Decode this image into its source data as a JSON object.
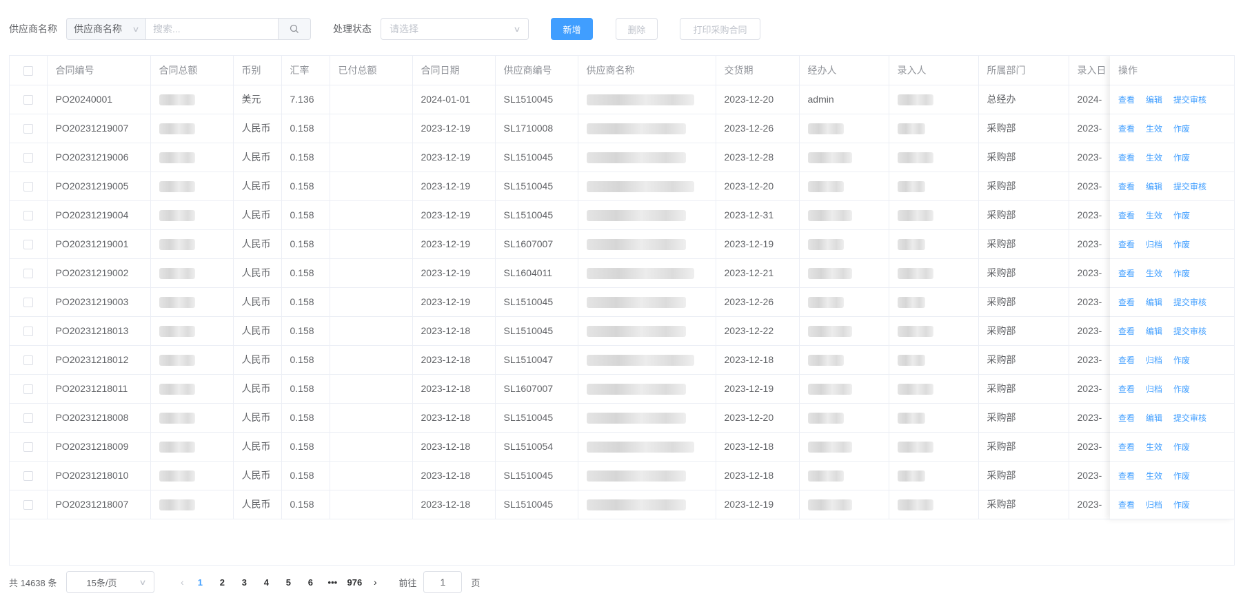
{
  "filters": {
    "supplier_label": "供应商名称",
    "supplier_select": "供应商名称",
    "search_placeholder": "搜索...",
    "status_label": "处理状态",
    "status_placeholder": "请选择"
  },
  "buttons": {
    "add": "新增",
    "delete": "删除",
    "print": "打印采购合同"
  },
  "table": {
    "headers": {
      "contract_no": "合同编号",
      "total": "合同总额",
      "currency": "币别",
      "rate": "汇率",
      "paid": "已付总额",
      "date": "合同日期",
      "supplier_no": "供应商编号",
      "supplier_name": "供应商名称",
      "delivery": "交货期",
      "handler": "经办人",
      "entered_by": "录入人",
      "dept": "所属部门",
      "entry_date": "录入日",
      "ops": "操作"
    },
    "rows": [
      {
        "no": "PO20240001",
        "currency": "美元",
        "rate": "7.136",
        "date": "2024-01-01",
        "supplier_no": "SL1510045",
        "delivery": "2023-12-20",
        "handler": "admin",
        "dept": "总经办",
        "entry": "2024-",
        "ops": [
          "查看",
          "编辑",
          "提交审核"
        ]
      },
      {
        "no": "PO20231219007",
        "currency": "人民币",
        "rate": "0.158",
        "date": "2023-12-19",
        "supplier_no": "SL1710008",
        "delivery": "2023-12-26",
        "handler": "",
        "dept": "采购部",
        "entry": "2023-",
        "ops": [
          "查看",
          "生效",
          "作废"
        ]
      },
      {
        "no": "PO20231219006",
        "currency": "人民币",
        "rate": "0.158",
        "date": "2023-12-19",
        "supplier_no": "SL1510045",
        "delivery": "2023-12-28",
        "handler": "",
        "dept": "采购部",
        "entry": "2023-",
        "ops": [
          "查看",
          "生效",
          "作废"
        ]
      },
      {
        "no": "PO20231219005",
        "currency": "人民币",
        "rate": "0.158",
        "date": "2023-12-19",
        "supplier_no": "SL1510045",
        "delivery": "2023-12-20",
        "handler": "",
        "dept": "采购部",
        "entry": "2023-",
        "ops": [
          "查看",
          "编辑",
          "提交审核"
        ]
      },
      {
        "no": "PO20231219004",
        "currency": "人民币",
        "rate": "0.158",
        "date": "2023-12-19",
        "supplier_no": "SL1510045",
        "delivery": "2023-12-31",
        "handler": "",
        "dept": "采购部",
        "entry": "2023-",
        "ops": [
          "查看",
          "生效",
          "作废"
        ]
      },
      {
        "no": "PO20231219001",
        "currency": "人民币",
        "rate": "0.158",
        "date": "2023-12-19",
        "supplier_no": "SL1607007",
        "delivery": "2023-12-19",
        "handler": "",
        "dept": "采购部",
        "entry": "2023-",
        "ops": [
          "查看",
          "归档",
          "作废"
        ]
      },
      {
        "no": "PO20231219002",
        "currency": "人民币",
        "rate": "0.158",
        "date": "2023-12-19",
        "supplier_no": "SL1604011",
        "delivery": "2023-12-21",
        "handler": "",
        "dept": "采购部",
        "entry": "2023-",
        "ops": [
          "查看",
          "生效",
          "作废"
        ]
      },
      {
        "no": "PO20231219003",
        "currency": "人民币",
        "rate": "0.158",
        "date": "2023-12-19",
        "supplier_no": "SL1510045",
        "delivery": "2023-12-26",
        "handler": "",
        "dept": "采购部",
        "entry": "2023-",
        "ops": [
          "查看",
          "编辑",
          "提交审核"
        ]
      },
      {
        "no": "PO20231218013",
        "currency": "人民币",
        "rate": "0.158",
        "date": "2023-12-18",
        "supplier_no": "SL1510045",
        "delivery": "2023-12-22",
        "handler": "",
        "dept": "采购部",
        "entry": "2023-",
        "ops": [
          "查看",
          "编辑",
          "提交审核"
        ]
      },
      {
        "no": "PO20231218012",
        "currency": "人民币",
        "rate": "0.158",
        "date": "2023-12-18",
        "supplier_no": "SL1510047",
        "delivery": "2023-12-18",
        "handler": "",
        "dept": "采购部",
        "entry": "2023-",
        "ops": [
          "查看",
          "归档",
          "作废"
        ]
      },
      {
        "no": "PO20231218011",
        "currency": "人民币",
        "rate": "0.158",
        "date": "2023-12-18",
        "supplier_no": "SL1607007",
        "delivery": "2023-12-19",
        "handler": "",
        "dept": "采购部",
        "entry": "2023-",
        "ops": [
          "查看",
          "归档",
          "作废"
        ]
      },
      {
        "no": "PO20231218008",
        "currency": "人民币",
        "rate": "0.158",
        "date": "2023-12-18",
        "supplier_no": "SL1510045",
        "delivery": "2023-12-20",
        "handler": "",
        "dept": "采购部",
        "entry": "2023-",
        "ops": [
          "查看",
          "编辑",
          "提交审核"
        ]
      },
      {
        "no": "PO20231218009",
        "currency": "人民币",
        "rate": "0.158",
        "date": "2023-12-18",
        "supplier_no": "SL1510054",
        "delivery": "2023-12-18",
        "handler": "",
        "dept": "采购部",
        "entry": "2023-",
        "ops": [
          "查看",
          "生效",
          "作废"
        ]
      },
      {
        "no": "PO20231218010",
        "currency": "人民币",
        "rate": "0.158",
        "date": "2023-12-18",
        "supplier_no": "SL1510045",
        "delivery": "2023-12-18",
        "handler": "",
        "dept": "采购部",
        "entry": "2023-",
        "ops": [
          "查看",
          "生效",
          "作废"
        ]
      },
      {
        "no": "PO20231218007",
        "currency": "人民币",
        "rate": "0.158",
        "date": "2023-12-18",
        "supplier_no": "SL1510045",
        "delivery": "2023-12-19",
        "handler": "",
        "dept": "采购部",
        "entry": "2023-",
        "ops": [
          "查看",
          "归档",
          "作废"
        ]
      }
    ]
  },
  "pagination": {
    "total_text": "共 14638 条",
    "page_size": "15条/页",
    "pages": [
      "1",
      "2",
      "3",
      "4",
      "5",
      "6",
      "•••",
      "976"
    ],
    "current": "1",
    "goto_prefix": "前往",
    "goto_value": "1",
    "goto_suffix": "页",
    "prev_icon": "‹",
    "next_icon": "›"
  },
  "colors": {
    "primary": "#409eff",
    "border": "#ebeef5",
    "header_text": "#909399"
  }
}
